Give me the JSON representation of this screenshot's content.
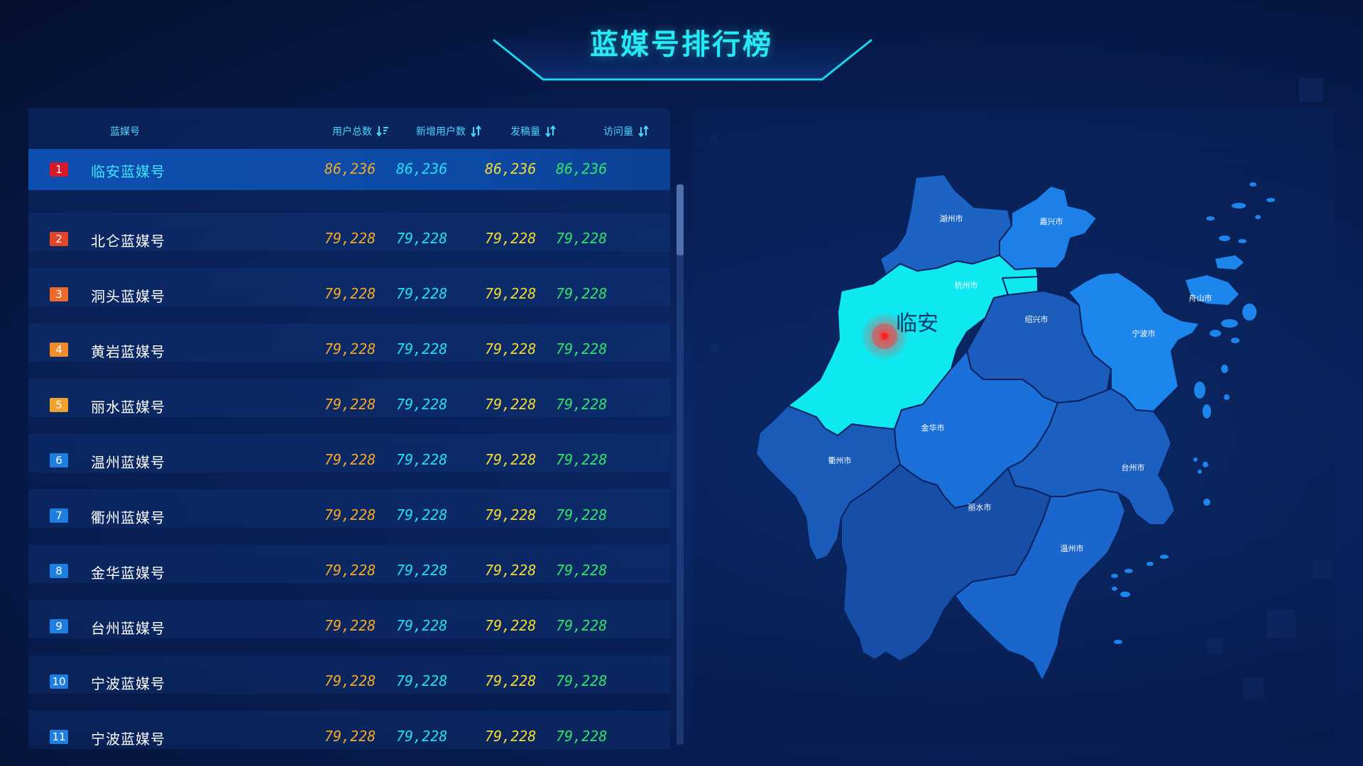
{
  "header": {
    "title": "蓝媒号排行榜"
  },
  "table": {
    "columns": [
      {
        "label": "蓝媒号",
        "sort_icon": "sort-desc-icon"
      },
      {
        "label": "用户总数",
        "sort_icon": "sort-desc-icon"
      },
      {
        "label": "新增用户数",
        "sort_icon": "sort-toggle-icon"
      },
      {
        "label": "发稿量",
        "sort_icon": "sort-toggle-icon"
      },
      {
        "label": "访问量",
        "sort_icon": "sort-toggle-icon"
      }
    ],
    "rows": [
      {
        "rank": "1",
        "name": "临安蓝媒号",
        "total": "86,236",
        "new": "86,236",
        "posts": "86,236",
        "visits": "86,236",
        "rank_color": "#d8192a"
      },
      {
        "rank": "2",
        "name": "北仑蓝媒号",
        "total": "79,228",
        "new": "79,228",
        "posts": "79,228",
        "visits": "79,228",
        "rank_color": "#e3462b"
      },
      {
        "rank": "3",
        "name": "洞头蓝媒号",
        "total": "79,228",
        "new": "79,228",
        "posts": "79,228",
        "visits": "79,228",
        "rank_color": "#ec6a2a"
      },
      {
        "rank": "4",
        "name": "黄岩蓝媒号",
        "total": "79,228",
        "new": "79,228",
        "posts": "79,228",
        "visits": "79,228",
        "rank_color": "#f08b2c"
      },
      {
        "rank": "5",
        "name": "丽水蓝媒号",
        "total": "79,228",
        "new": "79,228",
        "posts": "79,228",
        "visits": "79,228",
        "rank_color": "#f0a22f"
      },
      {
        "rank": "6",
        "name": "温州蓝媒号",
        "total": "79,228",
        "new": "79,228",
        "posts": "79,228",
        "visits": "79,228",
        "rank_color": "#1f7fe0"
      },
      {
        "rank": "7",
        "name": "衢州蓝媒号",
        "total": "79,228",
        "new": "79,228",
        "posts": "79,228",
        "visits": "79,228",
        "rank_color": "#1f7fe0"
      },
      {
        "rank": "8",
        "name": "金华蓝媒号",
        "total": "79,228",
        "new": "79,228",
        "posts": "79,228",
        "visits": "79,228",
        "rank_color": "#1f7fe0"
      },
      {
        "rank": "9",
        "name": "台州蓝媒号",
        "total": "79,228",
        "new": "79,228",
        "posts": "79,228",
        "visits": "79,228",
        "rank_color": "#1f7fe0"
      },
      {
        "rank": "10",
        "name": "宁波蓝媒号",
        "total": "79,228",
        "new": "79,228",
        "posts": "79,228",
        "visits": "79,228",
        "rank_color": "#1f7fe0"
      },
      {
        "rank": "11",
        "name": "宁波蓝媒号",
        "total": "79,228",
        "new": "79,228",
        "posts": "79,228",
        "visits": "79,228",
        "rank_color": "#1f7fe0"
      }
    ]
  },
  "map": {
    "cities": {
      "huzhou": "湖州市",
      "jiaxing": "嘉兴市",
      "hangzhou": "杭州市",
      "zhoushan": "舟山市",
      "shaoxing": "绍兴市",
      "ningbo": "宁波市",
      "jinhua": "金华市",
      "quzhou": "衢州市",
      "taizhou": "台州市",
      "lishui": "丽水市",
      "wenzhou": "温州市"
    },
    "highlight": "临安",
    "highlight_color": "#0ee8f0",
    "marker_icon": "location-pulse-icon"
  }
}
